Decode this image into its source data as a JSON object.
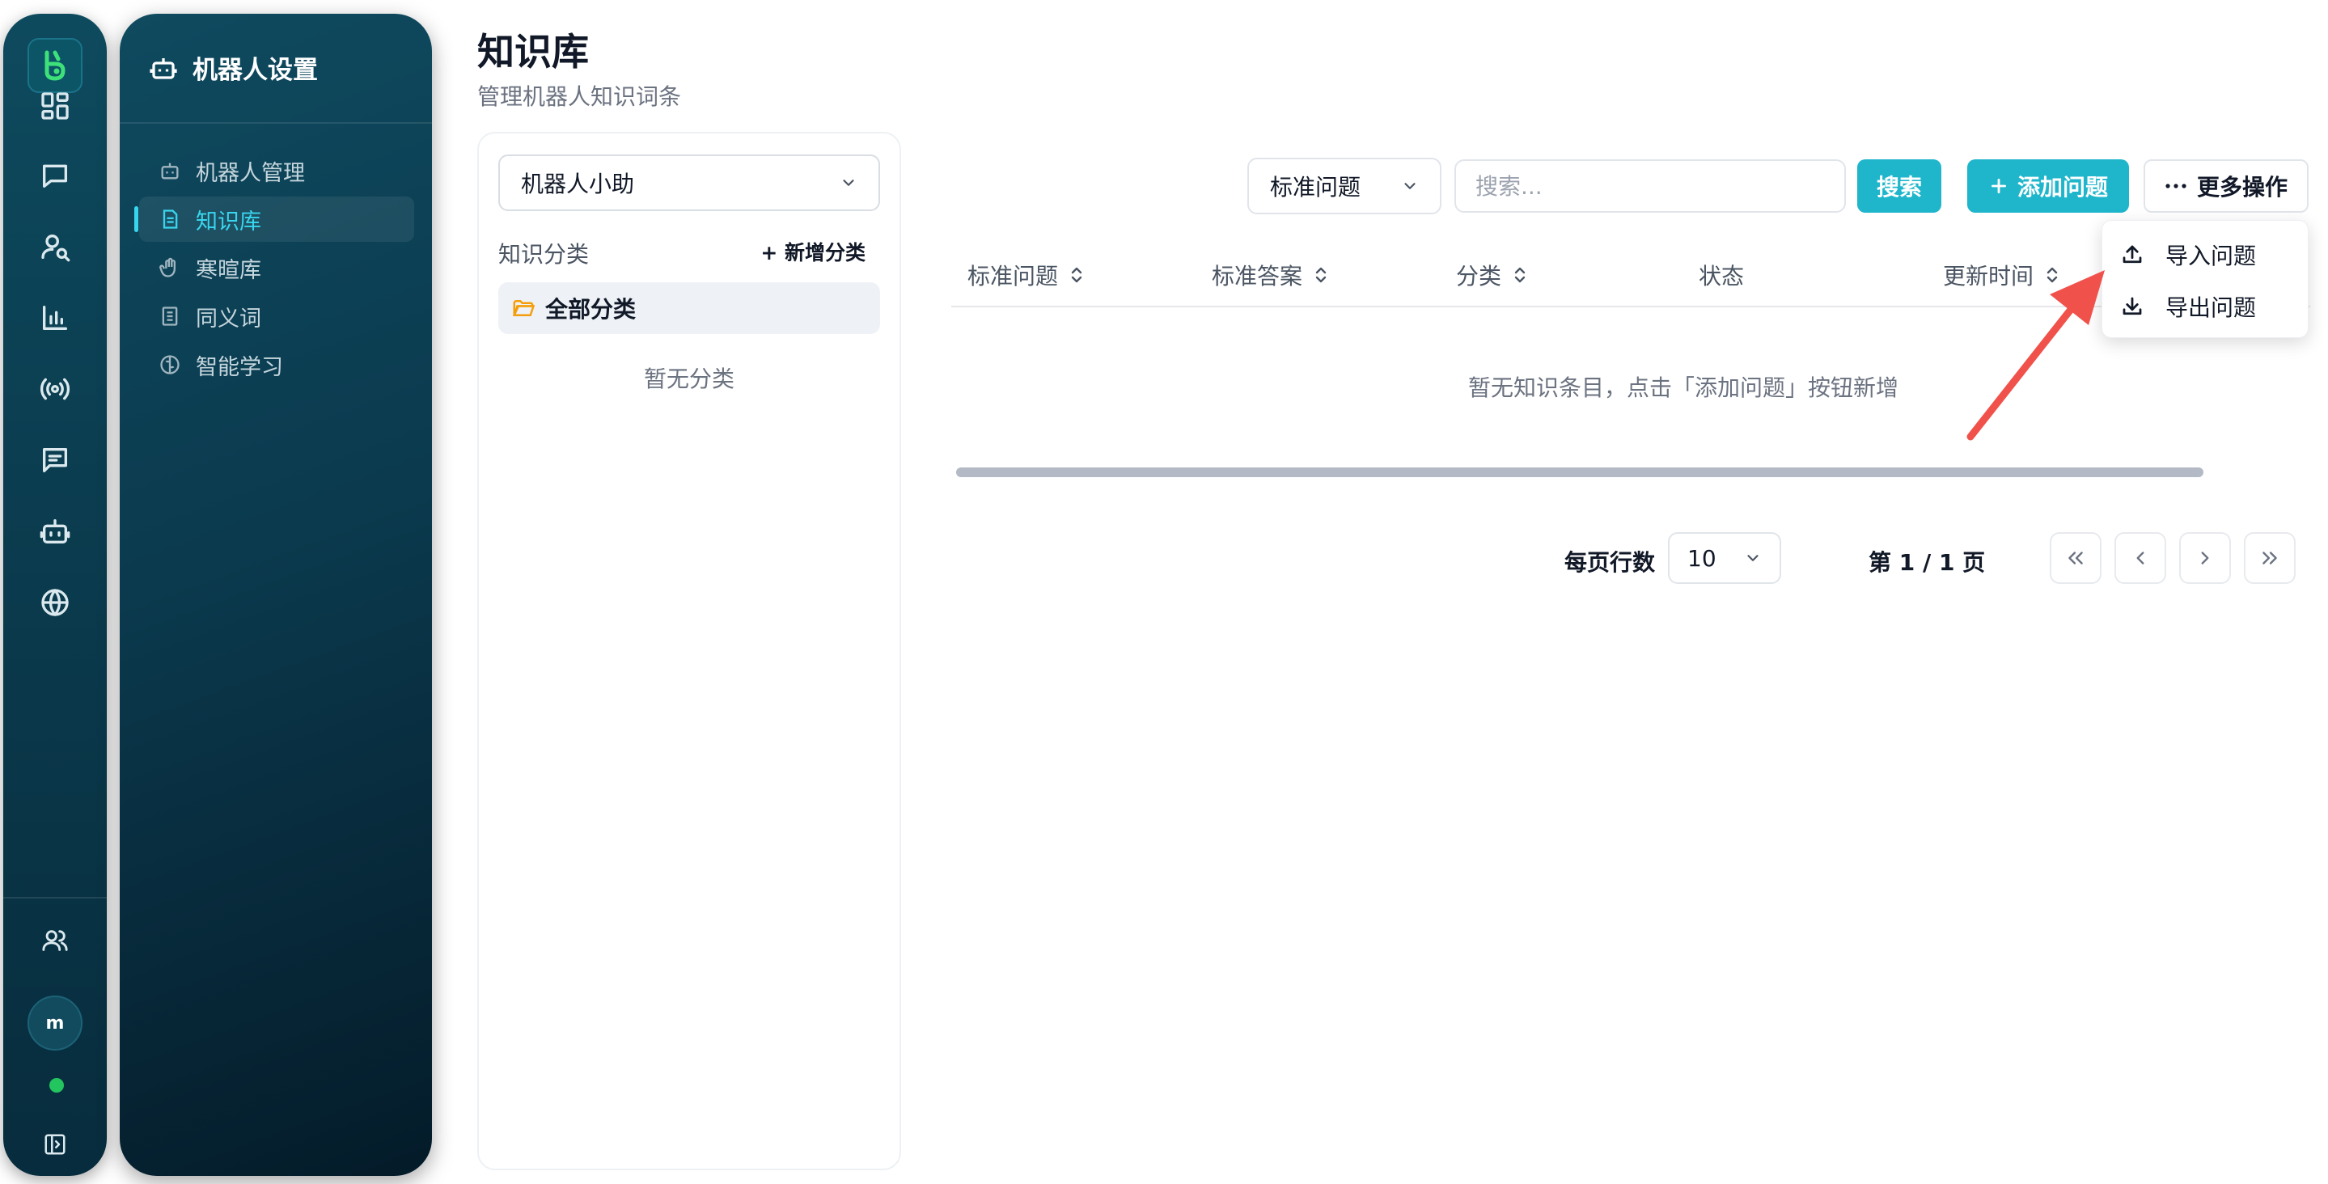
{
  "sidebar": {
    "avatar_initial": "m",
    "icons": [
      "dashboard-icon",
      "chat-icon",
      "user-search-icon",
      "bar-chart-icon",
      "broadcast-icon",
      "message-square-icon",
      "bot-icon",
      "globe-icon",
      "users-icon",
      "panel-toggle-icon"
    ]
  },
  "settings_panel": {
    "title": "机器人设置",
    "items": [
      {
        "label": "机器人管理",
        "icon": "bot-icon"
      },
      {
        "label": "知识库",
        "icon": "document-icon",
        "active": true
      },
      {
        "label": "寒暄库",
        "icon": "hand-icon"
      },
      {
        "label": "同义词",
        "icon": "book-icon"
      },
      {
        "label": "智能学习",
        "icon": "brain-icon"
      }
    ]
  },
  "page": {
    "title": "知识库",
    "subtitle": "管理机器人知识词条"
  },
  "category_panel": {
    "robot_select": "机器人小助",
    "section_title": "知识分类",
    "add_category": "新增分类",
    "all_categories": "全部分类",
    "empty_text": "暂无分类"
  },
  "toolbar": {
    "field_select": "标准问题",
    "search_placeholder": "搜索...",
    "search_button": "搜索",
    "add_button": "添加问题",
    "more_button": "更多操作"
  },
  "dropdown": {
    "items": [
      {
        "label": "导入问题",
        "icon": "upload-icon"
      },
      {
        "label": "导出问题",
        "icon": "download-icon"
      }
    ]
  },
  "table": {
    "columns": [
      "标准问题",
      "标准答案",
      "分类",
      "状态",
      "更新时间"
    ],
    "empty_text": "暂无知识条目，点击「添加问题」按钮新增"
  },
  "pagination": {
    "rows_label": "每页行数",
    "rows_value": "10",
    "page_info": "第 1 / 1 页"
  },
  "colors": {
    "accent": "#1fb6cc",
    "sidebar_bg": "#0b3d50",
    "active_nav": "#38d6ee",
    "arrow": "#f0524b"
  }
}
